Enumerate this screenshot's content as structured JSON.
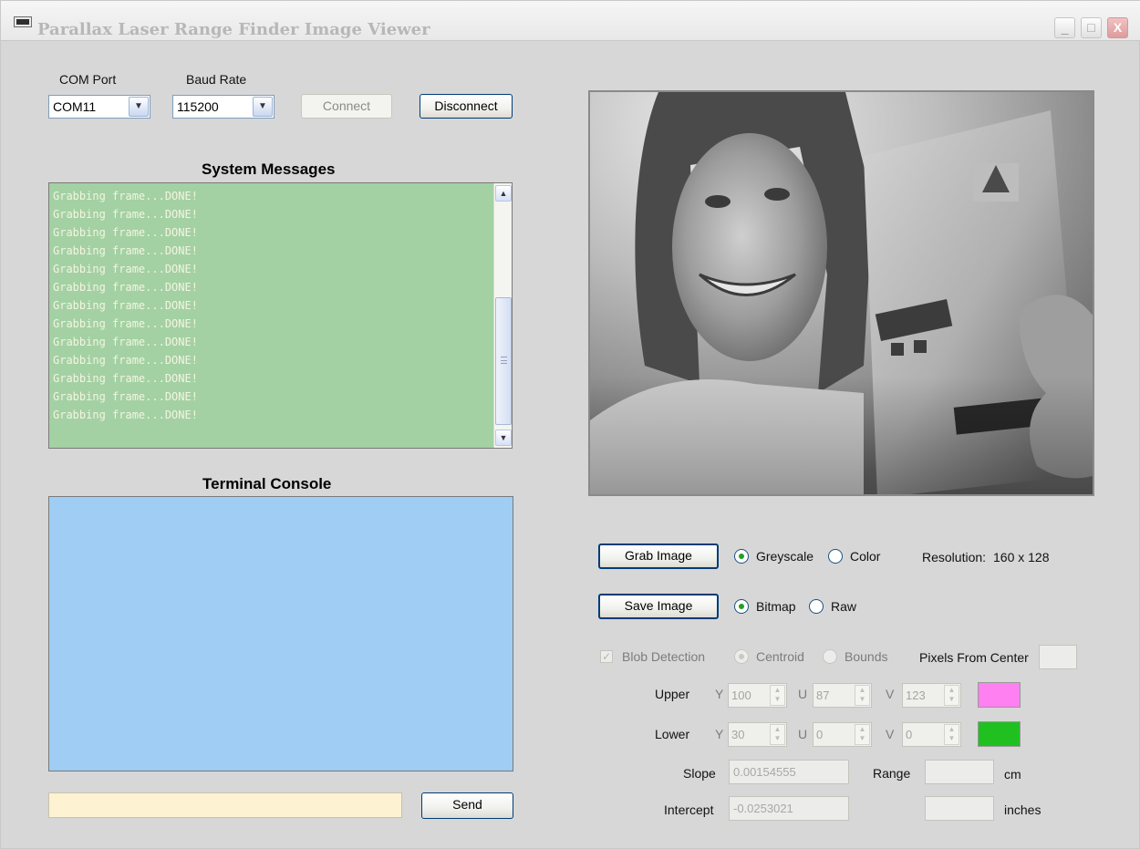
{
  "window": {
    "title": "Parallax Laser Range Finder Image Viewer",
    "controls": [
      "_",
      "□",
      "X"
    ]
  },
  "connection": {
    "com_label": "COM Port",
    "com_value": "COM11",
    "baud_label": "Baud Rate",
    "baud_value": "115200",
    "connect_label": "Connect",
    "disconnect_label": "Disconnect"
  },
  "system_messages": {
    "title": "System Messages",
    "lines": [
      "Grabbing frame...DONE!",
      "Grabbing frame...DONE!",
      "Grabbing frame...DONE!",
      "Grabbing frame...DONE!",
      "Grabbing frame...DONE!",
      "Grabbing frame...DONE!",
      "Grabbing frame...DONE!",
      "Grabbing frame...DONE!",
      "Grabbing frame...DONE!",
      "Grabbing frame...DONE!",
      "Grabbing frame...DONE!",
      "Grabbing frame...DONE!",
      "Grabbing frame...DONE!"
    ],
    "bg_color": "#a3d1a3"
  },
  "terminal": {
    "title": "Terminal Console",
    "input_value": "",
    "send_label": "Send",
    "bg_color": "#9fcdf3"
  },
  "image_controls": {
    "grab_label": "Grab Image",
    "greyscale_label": "Greyscale",
    "color_label": "Color",
    "resolution_label": "Resolution:",
    "resolution_value": "160 x 128",
    "save_label": "Save Image",
    "bitmap_label": "Bitmap",
    "raw_label": "Raw"
  },
  "blob": {
    "detection_label": "Blob Detection",
    "centroid_label": "Centroid",
    "bounds_label": "Bounds",
    "pixels_label": "Pixels From Center",
    "pixels_value": "",
    "upper_label": "Upper",
    "lower_label": "Lower",
    "y_label": "Y",
    "u_label": "U",
    "v_label": "V",
    "upper": {
      "y": "100",
      "u": "87",
      "v": "123",
      "color": "#ff80f0"
    },
    "lower": {
      "y": "30",
      "u": "0",
      "v": "0",
      "color": "#20c020"
    },
    "slope_label": "Slope",
    "slope_value": "0.00154555",
    "intercept_label": "Intercept",
    "intercept_value": "-0.0253021",
    "range_label": "Range",
    "range_cm_value": "",
    "cm_label": "cm",
    "range_in_value": "",
    "inches_label": "inches"
  }
}
